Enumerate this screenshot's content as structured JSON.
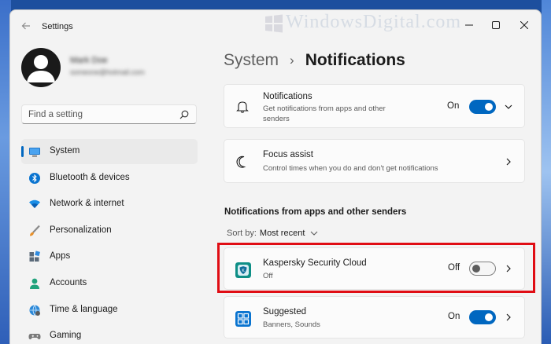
{
  "window": {
    "title": "Settings"
  },
  "profile": {
    "name": "Mark Doe",
    "email": "someone@hotmail.com"
  },
  "search": {
    "placeholder": "Find a setting"
  },
  "sidebar": {
    "items": [
      {
        "label": "System",
        "icon": "system-icon",
        "active": true
      },
      {
        "label": "Bluetooth & devices",
        "icon": "bluetooth-icon"
      },
      {
        "label": "Network & internet",
        "icon": "wifi-icon"
      },
      {
        "label": "Personalization",
        "icon": "brush-icon"
      },
      {
        "label": "Apps",
        "icon": "apps-icon"
      },
      {
        "label": "Accounts",
        "icon": "accounts-icon"
      },
      {
        "label": "Time & language",
        "icon": "globe-icon"
      },
      {
        "label": "Gaming",
        "icon": "gamepad-icon"
      }
    ]
  },
  "breadcrumb": {
    "parent": "System",
    "separator": "›",
    "current": "Notifications"
  },
  "notifications_card": {
    "title": "Notifications",
    "subtitle": "Get notifications from apps and other senders",
    "state": "On",
    "icon": "bell-icon"
  },
  "focus_card": {
    "title": "Focus assist",
    "subtitle": "Control times when you do and don't get notifications",
    "icon": "moon-icon"
  },
  "apps_section": {
    "title": "Notifications from apps and other senders",
    "sort_label": "Sort by:",
    "sort_value": "Most recent"
  },
  "apps": [
    {
      "name": "Kaspersky Security Cloud",
      "status": "Off",
      "toggle": "Off",
      "icon": "kaspersky-icon"
    },
    {
      "name": "Suggested",
      "status": "Banners, Sounds",
      "toggle": "On",
      "icon": "suggested-icon"
    }
  ],
  "watermark": {
    "text": "WindowsDigital.com"
  },
  "colors": {
    "accent": "#0067c0",
    "highlight": "#e00d14",
    "background": "#f3f3f3"
  }
}
